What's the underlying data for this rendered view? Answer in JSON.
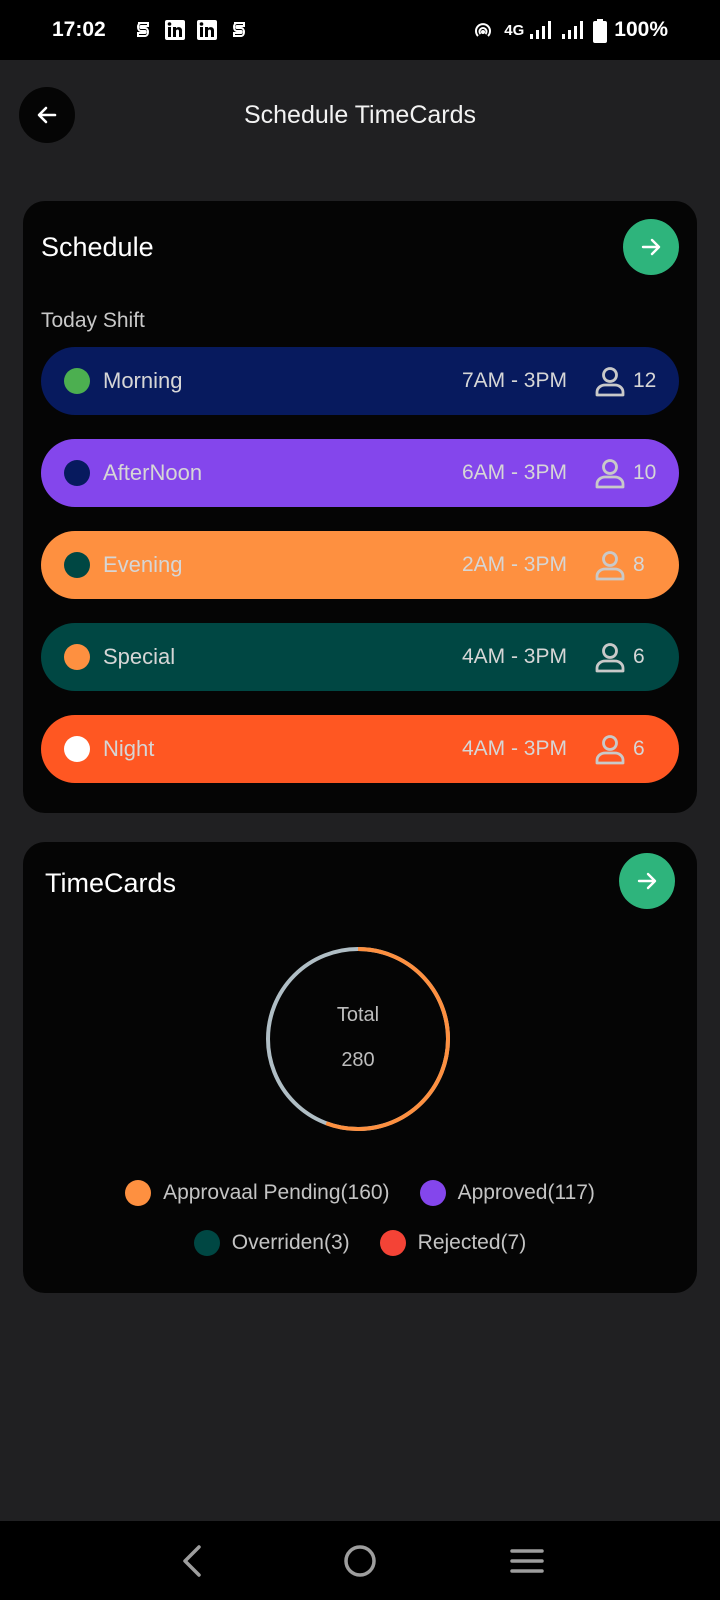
{
  "status_bar": {
    "time": "17:02",
    "network": "4G",
    "battery": "100%",
    "notification_icons": [
      "s-app-icon",
      "linkedin-icon",
      "linkedin-icon",
      "s-app-icon"
    ]
  },
  "header": {
    "title": "Schedule TimeCards"
  },
  "schedule": {
    "title": "Schedule",
    "section_label": "Today Shift",
    "shifts": [
      {
        "name": "Morning",
        "time": "7AM - 3PM",
        "count": "12",
        "bg": "#071a5e",
        "dot": "#4caf50"
      },
      {
        "name": "AfterNoon",
        "time": "6AM - 3PM",
        "count": "10",
        "bg": "#8446ec",
        "dot": "#071a5e"
      },
      {
        "name": "Evening",
        "time": "2AM - 3PM",
        "count": "8",
        "bg": "#fe9040",
        "dot": "#004743"
      },
      {
        "name": "Special",
        "time": "4AM - 3PM",
        "count": "6",
        "bg": "#004743",
        "dot": "#fe9040"
      },
      {
        "name": "Night",
        "time": "4AM - 3PM",
        "count": "6",
        "bg": "#ff5722",
        "dot": "#ffffff"
      }
    ]
  },
  "timecards": {
    "title": "TimeCards",
    "total_label": "Total",
    "total_value": "280",
    "legend": [
      {
        "label": "Approvaal Pending(160)",
        "color": "#fe9040",
        "value": 160
      },
      {
        "label": "Approved(117)",
        "color": "#8446ec",
        "value": 117
      },
      {
        "label": "Overriden(3)",
        "color": "#004743",
        "value": 3
      },
      {
        "label": "Rejected(7)",
        "color": "#f44336",
        "value": 7
      }
    ]
  },
  "colors": {
    "accent": "#2eb47c",
    "background": "#202022",
    "card": "#050505"
  }
}
